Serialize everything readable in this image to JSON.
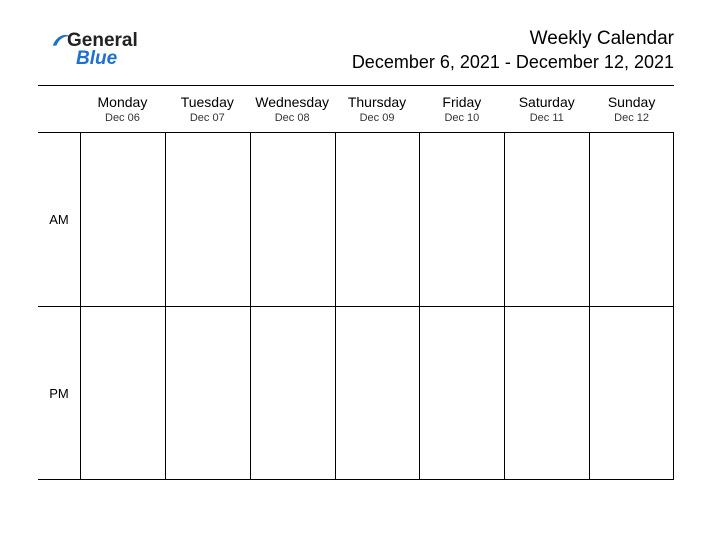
{
  "logo": {
    "text1": "General",
    "text2": "Blue"
  },
  "header": {
    "title": "Weekly Calendar",
    "subtitle": "December 6, 2021 - December 12, 2021"
  },
  "rows": [
    {
      "label": "AM"
    },
    {
      "label": "PM"
    }
  ],
  "days": [
    {
      "name": "Monday",
      "date": "Dec 06"
    },
    {
      "name": "Tuesday",
      "date": "Dec 07"
    },
    {
      "name": "Wednesday",
      "date": "Dec 08"
    },
    {
      "name": "Thursday",
      "date": "Dec 09"
    },
    {
      "name": "Friday",
      "date": "Dec 10"
    },
    {
      "name": "Saturday",
      "date": "Dec 11"
    },
    {
      "name": "Sunday",
      "date": "Dec 12"
    }
  ]
}
